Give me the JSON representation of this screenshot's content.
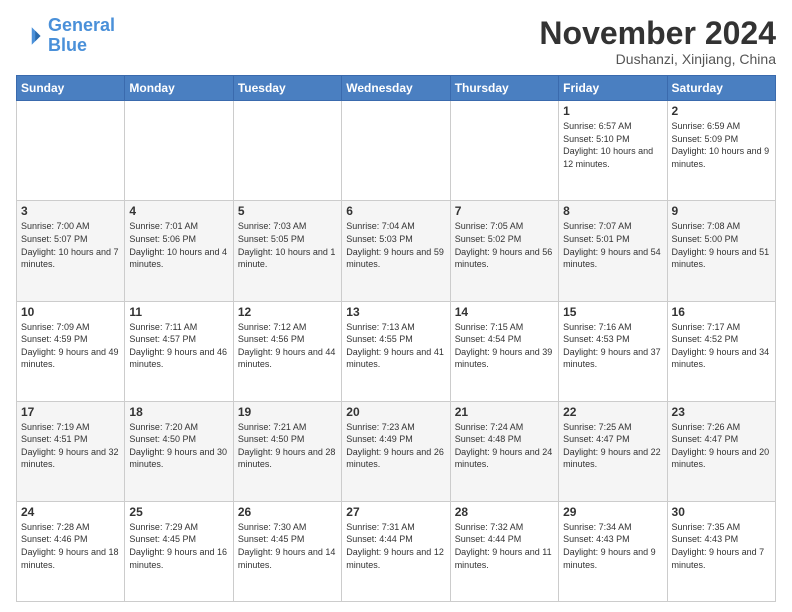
{
  "logo": {
    "line1": "General",
    "line2": "Blue"
  },
  "title": "November 2024",
  "location": "Dushanzi, Xinjiang, China",
  "days_of_week": [
    "Sunday",
    "Monday",
    "Tuesday",
    "Wednesday",
    "Thursday",
    "Friday",
    "Saturday"
  ],
  "weeks": [
    [
      {
        "day": "",
        "info": ""
      },
      {
        "day": "",
        "info": ""
      },
      {
        "day": "",
        "info": ""
      },
      {
        "day": "",
        "info": ""
      },
      {
        "day": "",
        "info": ""
      },
      {
        "day": "1",
        "info": "Sunrise: 6:57 AM\nSunset: 5:10 PM\nDaylight: 10 hours and 12 minutes."
      },
      {
        "day": "2",
        "info": "Sunrise: 6:59 AM\nSunset: 5:09 PM\nDaylight: 10 hours and 9 minutes."
      }
    ],
    [
      {
        "day": "3",
        "info": "Sunrise: 7:00 AM\nSunset: 5:07 PM\nDaylight: 10 hours and 7 minutes."
      },
      {
        "day": "4",
        "info": "Sunrise: 7:01 AM\nSunset: 5:06 PM\nDaylight: 10 hours and 4 minutes."
      },
      {
        "day": "5",
        "info": "Sunrise: 7:03 AM\nSunset: 5:05 PM\nDaylight: 10 hours and 1 minute."
      },
      {
        "day": "6",
        "info": "Sunrise: 7:04 AM\nSunset: 5:03 PM\nDaylight: 9 hours and 59 minutes."
      },
      {
        "day": "7",
        "info": "Sunrise: 7:05 AM\nSunset: 5:02 PM\nDaylight: 9 hours and 56 minutes."
      },
      {
        "day": "8",
        "info": "Sunrise: 7:07 AM\nSunset: 5:01 PM\nDaylight: 9 hours and 54 minutes."
      },
      {
        "day": "9",
        "info": "Sunrise: 7:08 AM\nSunset: 5:00 PM\nDaylight: 9 hours and 51 minutes."
      }
    ],
    [
      {
        "day": "10",
        "info": "Sunrise: 7:09 AM\nSunset: 4:59 PM\nDaylight: 9 hours and 49 minutes."
      },
      {
        "day": "11",
        "info": "Sunrise: 7:11 AM\nSunset: 4:57 PM\nDaylight: 9 hours and 46 minutes."
      },
      {
        "day": "12",
        "info": "Sunrise: 7:12 AM\nSunset: 4:56 PM\nDaylight: 9 hours and 44 minutes."
      },
      {
        "day": "13",
        "info": "Sunrise: 7:13 AM\nSunset: 4:55 PM\nDaylight: 9 hours and 41 minutes."
      },
      {
        "day": "14",
        "info": "Sunrise: 7:15 AM\nSunset: 4:54 PM\nDaylight: 9 hours and 39 minutes."
      },
      {
        "day": "15",
        "info": "Sunrise: 7:16 AM\nSunset: 4:53 PM\nDaylight: 9 hours and 37 minutes."
      },
      {
        "day": "16",
        "info": "Sunrise: 7:17 AM\nSunset: 4:52 PM\nDaylight: 9 hours and 34 minutes."
      }
    ],
    [
      {
        "day": "17",
        "info": "Sunrise: 7:19 AM\nSunset: 4:51 PM\nDaylight: 9 hours and 32 minutes."
      },
      {
        "day": "18",
        "info": "Sunrise: 7:20 AM\nSunset: 4:50 PM\nDaylight: 9 hours and 30 minutes."
      },
      {
        "day": "19",
        "info": "Sunrise: 7:21 AM\nSunset: 4:50 PM\nDaylight: 9 hours and 28 minutes."
      },
      {
        "day": "20",
        "info": "Sunrise: 7:23 AM\nSunset: 4:49 PM\nDaylight: 9 hours and 26 minutes."
      },
      {
        "day": "21",
        "info": "Sunrise: 7:24 AM\nSunset: 4:48 PM\nDaylight: 9 hours and 24 minutes."
      },
      {
        "day": "22",
        "info": "Sunrise: 7:25 AM\nSunset: 4:47 PM\nDaylight: 9 hours and 22 minutes."
      },
      {
        "day": "23",
        "info": "Sunrise: 7:26 AM\nSunset: 4:47 PM\nDaylight: 9 hours and 20 minutes."
      }
    ],
    [
      {
        "day": "24",
        "info": "Sunrise: 7:28 AM\nSunset: 4:46 PM\nDaylight: 9 hours and 18 minutes."
      },
      {
        "day": "25",
        "info": "Sunrise: 7:29 AM\nSunset: 4:45 PM\nDaylight: 9 hours and 16 minutes."
      },
      {
        "day": "26",
        "info": "Sunrise: 7:30 AM\nSunset: 4:45 PM\nDaylight: 9 hours and 14 minutes."
      },
      {
        "day": "27",
        "info": "Sunrise: 7:31 AM\nSunset: 4:44 PM\nDaylight: 9 hours and 12 minutes."
      },
      {
        "day": "28",
        "info": "Sunrise: 7:32 AM\nSunset: 4:44 PM\nDaylight: 9 hours and 11 minutes."
      },
      {
        "day": "29",
        "info": "Sunrise: 7:34 AM\nSunset: 4:43 PM\nDaylight: 9 hours and 9 minutes."
      },
      {
        "day": "30",
        "info": "Sunrise: 7:35 AM\nSunset: 4:43 PM\nDaylight: 9 hours and 7 minutes."
      }
    ]
  ]
}
